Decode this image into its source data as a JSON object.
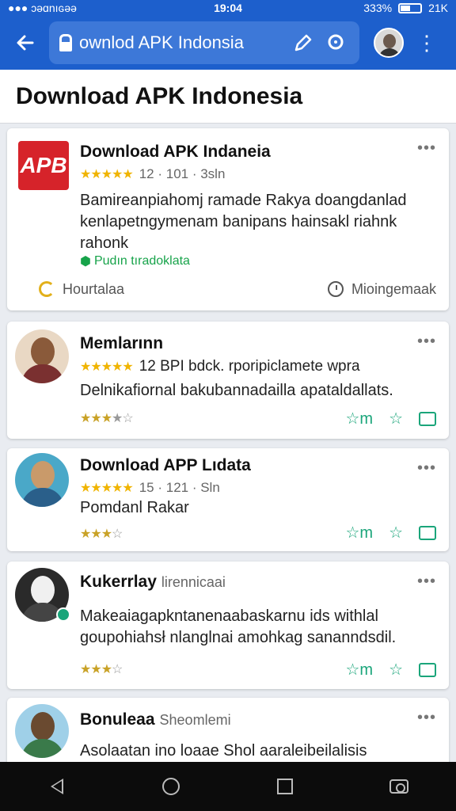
{
  "status_bar": {
    "left_text": "●●● ɔəɑnıɢəə",
    "time": "19:04",
    "right_text": "333%",
    "extra": "21K"
  },
  "app_bar": {
    "url_text": "ownlod APK Indonsia"
  },
  "page": {
    "title": "Download APK Indonesia"
  },
  "cards": [
    {
      "logo_text": "APB",
      "title": "Download APK Indaneia",
      "stars": "★★★★★",
      "meta": "12 · 101 · 3sln",
      "description": "Bamireanpiahomj ramade Rakya doangdanlad kenlapetngymenam banipans hainsakl riahnk rahonk",
      "tag": "Pudın tıradoklata",
      "footer_left": "Hourtalaa",
      "footer_right": "Mioingemaak"
    },
    {
      "title": "Memlarınn",
      "stars": "★★★★★",
      "meta": "12 BPI bdck. rporipiclamete wpra",
      "description": "Delnikafiornal bakubannadailla apataldallats.",
      "rating_gold": "★★★",
      "rating_grey": "★☆"
    },
    {
      "title": "Download APP Lıdata",
      "stars": "★★★★★",
      "meta": "15 · 121 · Sln",
      "description": "Pomdanl Rakar",
      "rating_gold": "★★★",
      "rating_grey": "☆"
    },
    {
      "title": "Kukerrlay",
      "subtitle": "lirennicaai",
      "description": "Makeaiagapkntanenaabaskarnu ids withlal goupohiahsł nlanglnai amohkag sananndsdil.",
      "rating_gold": "★★★",
      "rating_grey": "☆"
    },
    {
      "title": "Bonuleaa",
      "subtitle": "Sheomlemi",
      "description": "Asolaatan ino loaae Shol aaraleibeilalisis"
    }
  ],
  "actions": {
    "label": "☆m",
    "star": "☆"
  },
  "colors": {
    "brand_blue": "#1d5fcc",
    "star_gold": "#f0b400",
    "action_green": "#1aa57a",
    "tag_green": "#17a34a",
    "logo_red": "#d6232a"
  },
  "icons": [
    "back-arrow-icon",
    "lock-icon",
    "edit-pen-icon",
    "search-icon",
    "more-vert-icon",
    "nav-back-icon",
    "nav-home-icon",
    "nav-recents-icon",
    "camera-icon"
  ]
}
